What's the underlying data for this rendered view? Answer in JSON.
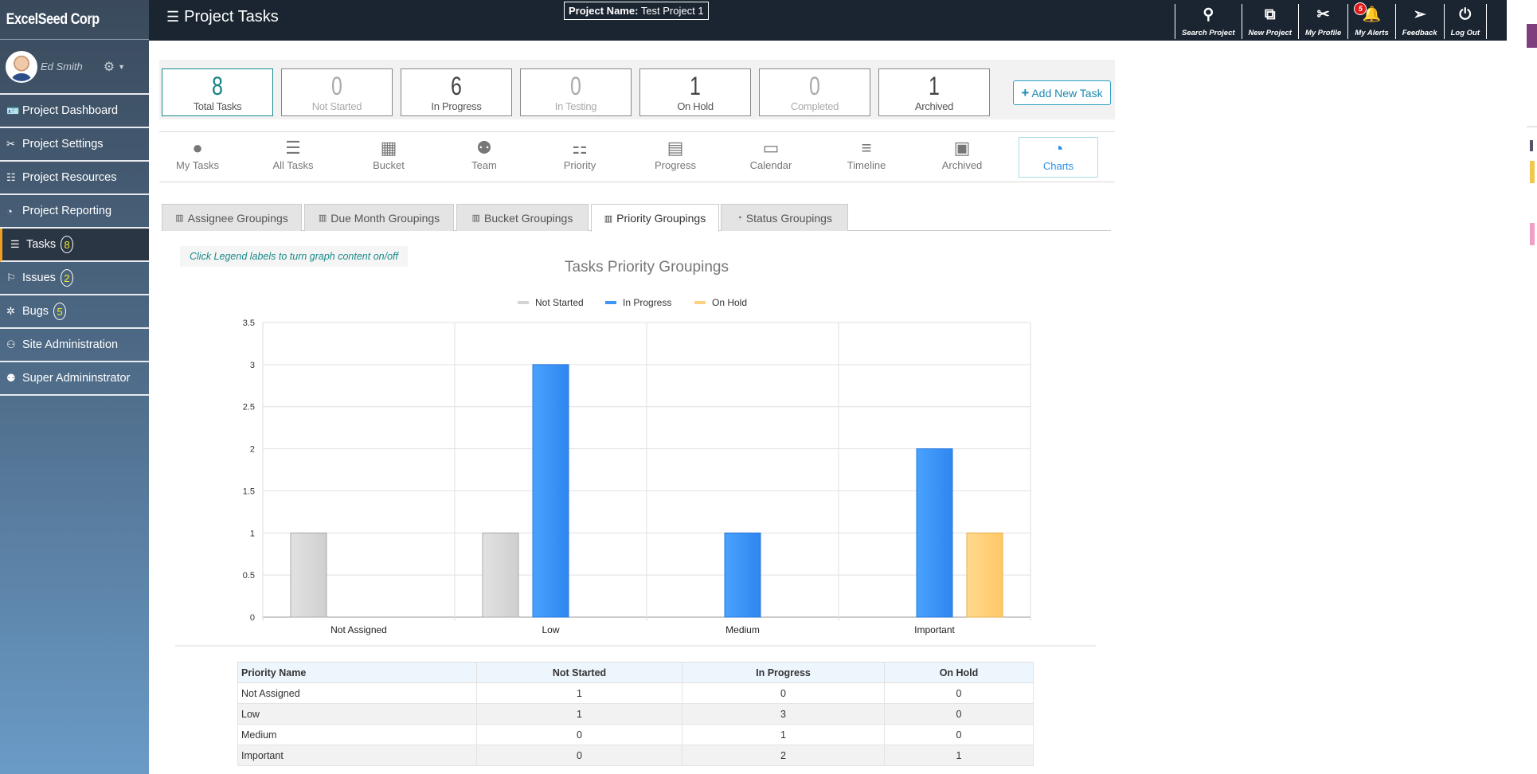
{
  "sidebar": {
    "brand": "ExcelSeed Corp",
    "user_name": "Ed Smith",
    "items": [
      {
        "label": "Project Dashboard",
        "icon": "id-card-icon"
      },
      {
        "label": "Project Settings",
        "icon": "tools-icon"
      },
      {
        "label": "Project Resources",
        "icon": "resources-icon"
      },
      {
        "label": "Project Reporting",
        "icon": "pie-chart-icon"
      },
      {
        "label": "Tasks",
        "icon": "task-list-icon",
        "badge": "8",
        "active": true
      },
      {
        "label": "Issues",
        "icon": "flag-icon",
        "badge": "2"
      },
      {
        "label": "Bugs",
        "icon": "bug-icon",
        "badge": "5"
      },
      {
        "label": "Site Administration",
        "icon": "user-gear-icon"
      },
      {
        "label": "Super Admininstrator",
        "icon": "user-shield-icon"
      }
    ]
  },
  "header": {
    "title": "Project Tasks",
    "project_name_label": "Project Name:",
    "project_name": "Test Project 1",
    "actions": [
      {
        "label": "Search Project",
        "icon": "search-icon"
      },
      {
        "label": "New Project",
        "icon": "layers-plus-icon"
      },
      {
        "label": "My Profile",
        "icon": "tools-icon"
      },
      {
        "label": "My Alerts",
        "icon": "bell-icon",
        "badge": "5"
      },
      {
        "label": "Feedback",
        "icon": "paper-plane-icon"
      },
      {
        "label": "Log Out",
        "icon": "power-icon"
      }
    ]
  },
  "stats": [
    {
      "value": "8",
      "label": "Total Tasks"
    },
    {
      "value": "0",
      "label": "Not Started"
    },
    {
      "value": "6",
      "label": "In Progress"
    },
    {
      "value": "0",
      "label": "In Testing"
    },
    {
      "value": "1",
      "label": "On Hold"
    },
    {
      "value": "0",
      "label": "Completed"
    },
    {
      "value": "1",
      "label": "Archived"
    }
  ],
  "add_task_label": "Add New Task",
  "views": [
    {
      "label": "My Tasks",
      "icon": "user-icon"
    },
    {
      "label": "All Tasks",
      "icon": "list-icon"
    },
    {
      "label": "Bucket",
      "icon": "grid-icon"
    },
    {
      "label": "Team",
      "icon": "team-icon"
    },
    {
      "label": "Priority",
      "icon": "hierarchy-icon"
    },
    {
      "label": "Progress",
      "icon": "server-icon"
    },
    {
      "label": "Calendar",
      "icon": "calendar-icon"
    },
    {
      "label": "Timeline",
      "icon": "timeline-icon"
    },
    {
      "label": "Archived",
      "icon": "archive-icon"
    },
    {
      "label": "Charts",
      "icon": "pie-chart-icon",
      "active": true
    }
  ],
  "group_tabs": [
    {
      "label": "Assignee Groupings",
      "icon": "bar-chart-icon"
    },
    {
      "label": "Due Month Groupings",
      "icon": "bar-chart-icon"
    },
    {
      "label": "Bucket Groupings",
      "icon": "bar-chart-icon"
    },
    {
      "label": "Priority Groupings",
      "icon": "bar-chart-icon",
      "active": true
    },
    {
      "label": "Status Groupings",
      "icon": "pie-chart-icon"
    }
  ],
  "hint": "Click Legend labels to turn graph content on/off",
  "colors": {
    "not_started": "#d4d4d4",
    "in_progress": "#3d96f8",
    "on_hold": "#ffd17f",
    "accent_teal": "#138080",
    "topbar": "#1b2531"
  },
  "chart_data": {
    "type": "bar",
    "title": "Tasks Priority Groupings",
    "xlabel": "",
    "ylabel": "",
    "categories": [
      "Not Assigned",
      "Low",
      "Medium",
      "Important"
    ],
    "series": [
      {
        "name": "Not Started",
        "values": [
          1,
          1,
          0,
          0
        ],
        "color": "#d4d4d4"
      },
      {
        "name": "In Progress",
        "values": [
          0,
          3,
          1,
          2
        ],
        "color": "#3d96f8"
      },
      {
        "name": "On Hold",
        "values": [
          0,
          0,
          0,
          1
        ],
        "color": "#ffd17f"
      }
    ],
    "ylim": [
      0,
      3.5
    ],
    "yticks": [
      "0",
      "0.5",
      "1",
      "1.5",
      "2",
      "2.5",
      "3",
      "3.5"
    ],
    "grid": true,
    "legend": "top-center"
  },
  "table": {
    "headers": [
      "Priority Name",
      "Not Started",
      "In Progress",
      "On Hold"
    ],
    "rows": [
      [
        "Not Assigned",
        "1",
        "0",
        "0"
      ],
      [
        "Low",
        "1",
        "3",
        "0"
      ],
      [
        "Medium",
        "0",
        "1",
        "0"
      ],
      [
        "Important",
        "0",
        "2",
        "1"
      ]
    ]
  }
}
